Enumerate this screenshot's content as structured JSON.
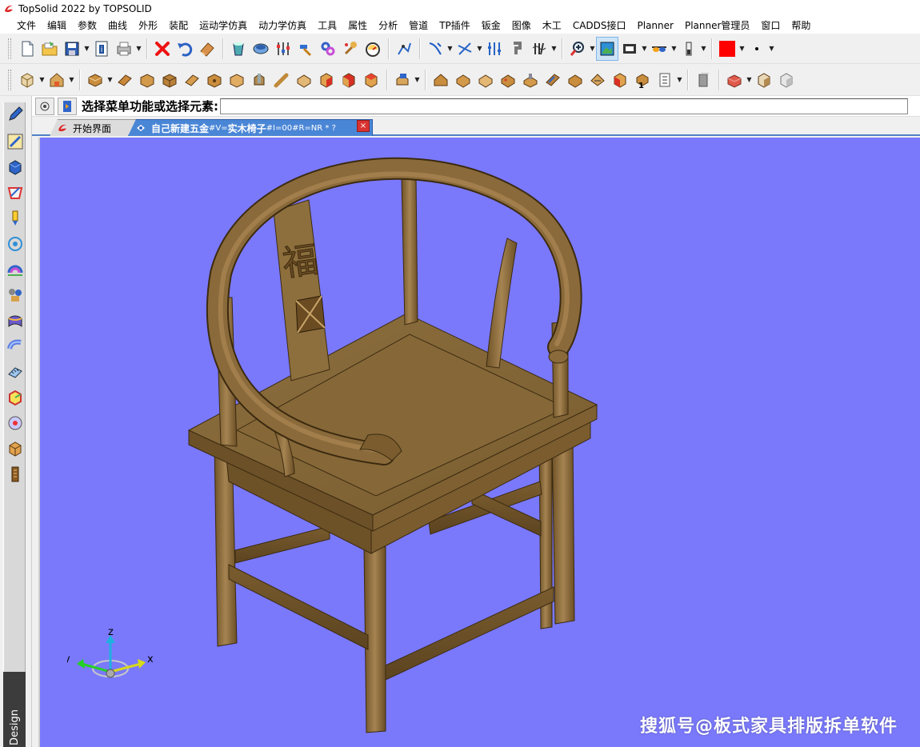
{
  "window": {
    "title": "TopSolid 2022 by TOPSOLID"
  },
  "menu": [
    "文件",
    "编辑",
    "参数",
    "曲线",
    "外形",
    "装配",
    "运动学仿真",
    "动力学仿真",
    "工具",
    "属性",
    "分析",
    "管道",
    "TP插件",
    "钣金",
    "图像",
    "木工",
    "CADDS接口",
    "Planner",
    "Planner管理员",
    "窗口",
    "帮助"
  ],
  "command": {
    "prompt": "选择菜单功能或选择元素:",
    "value": ""
  },
  "tabs": [
    {
      "label": "开始界面"
    },
    {
      "label_main": "自己新建五金",
      "label_small": "#V=",
      "label_main2": "实木椅子",
      "label_small2": "#I=00#R=NR * ?"
    }
  ],
  "tab_close": "×",
  "left_panel": {
    "label": "Design"
  },
  "viewport": {
    "background": "#7a79fc",
    "chair_carving": "福",
    "axis_labels": {
      "x": "x",
      "y": "y",
      "z": "z"
    },
    "watermark": "搜狐号@板式家具排版拆单软件"
  },
  "colors": {
    "accent_red": "#ff0000",
    "tab_active": "#4a86d6",
    "wood": "#8a6a3a"
  },
  "toolbar1_icons": [
    "new-file-icon",
    "open-folder-icon",
    "save-icon",
    "info-icon",
    "print-icon",
    "delete-icon",
    "undo-icon",
    "eraser-icon",
    "bucket-icon",
    "cylinder-icon",
    "sliders-icon",
    "hammer-icon",
    "link-icon",
    "wrench-icon",
    "gauge-icon",
    "node-icon",
    "curve-icon",
    "cross-icon",
    "params-icon",
    "hook-icon",
    "clip-icon",
    "zoom-icon",
    "fit-view-icon",
    "camera-view-icon",
    "glasses-icon",
    "battery-icon",
    "color-swatch-icon",
    "point-style-icon",
    "more-icon"
  ],
  "toolbar2_icons": [
    "box-icon",
    "home-box-icon",
    "profile-icon",
    "panel-icon",
    "panel2-icon",
    "panel3-icon",
    "panel4-icon",
    "panel5-icon",
    "panel6-icon",
    "drill-icon",
    "dowel-icon",
    "board-icon",
    "red-box-icon",
    "red-box2-icon",
    "red-box3-icon",
    "assembly-icon",
    "house-icon",
    "board2-icon",
    "board3-icon",
    "board4-icon",
    "hardware-icon",
    "board5-icon",
    "board6-icon",
    "board7-icon",
    "board8-icon",
    "number-icon",
    "gray-block-icon",
    "red-block-icon",
    "cube-icon",
    "cube-gray-icon"
  ]
}
